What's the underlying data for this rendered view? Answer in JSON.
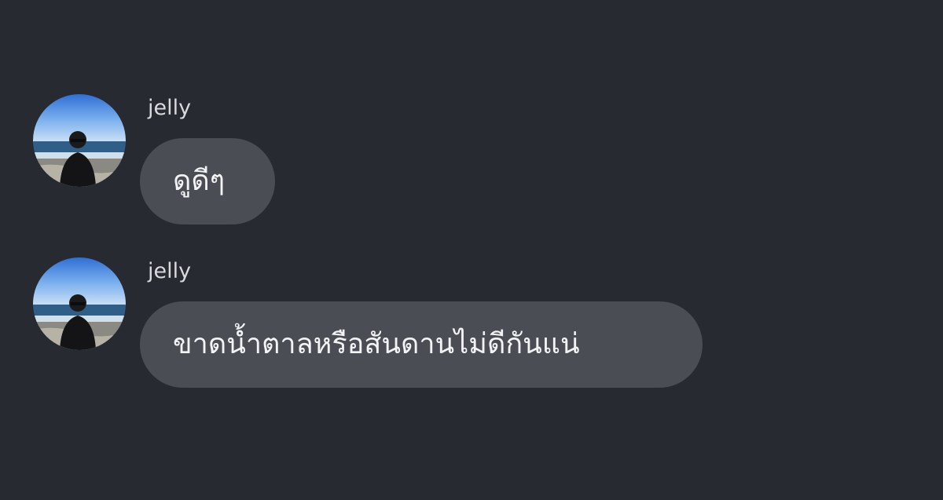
{
  "conversation": {
    "messages": [
      {
        "sender": "jelly",
        "text": "ดูดีๆ",
        "avatar": "profile-photo-icon"
      },
      {
        "sender": "jelly",
        "text": "ขาดน้ำตาลหรือสันดานไม่ดีกันแน่",
        "avatar": "profile-photo-icon"
      }
    ]
  },
  "colors": {
    "background": "#272a30",
    "bubble": "#4a4d53",
    "text": "#f2f3f5",
    "sender": "#d9dadd"
  }
}
